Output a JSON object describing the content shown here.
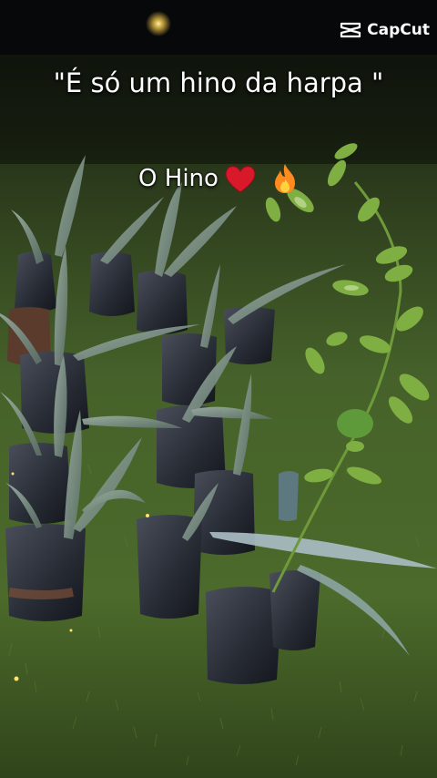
{
  "app": {
    "watermark": "CapCut"
  },
  "captions": {
    "line1": "\"É só um hino da harpa \"",
    "line2": "O Hino"
  },
  "icons": {
    "logo": "capcut-logo-icon",
    "emoji1": "heart-icon",
    "emoji2": "fire-icon"
  },
  "colors": {
    "grass": "#3f5a22",
    "sky": "#05070a",
    "text": "#ffffff",
    "heart": "#d7192a",
    "fire": "#ff8a1e"
  }
}
